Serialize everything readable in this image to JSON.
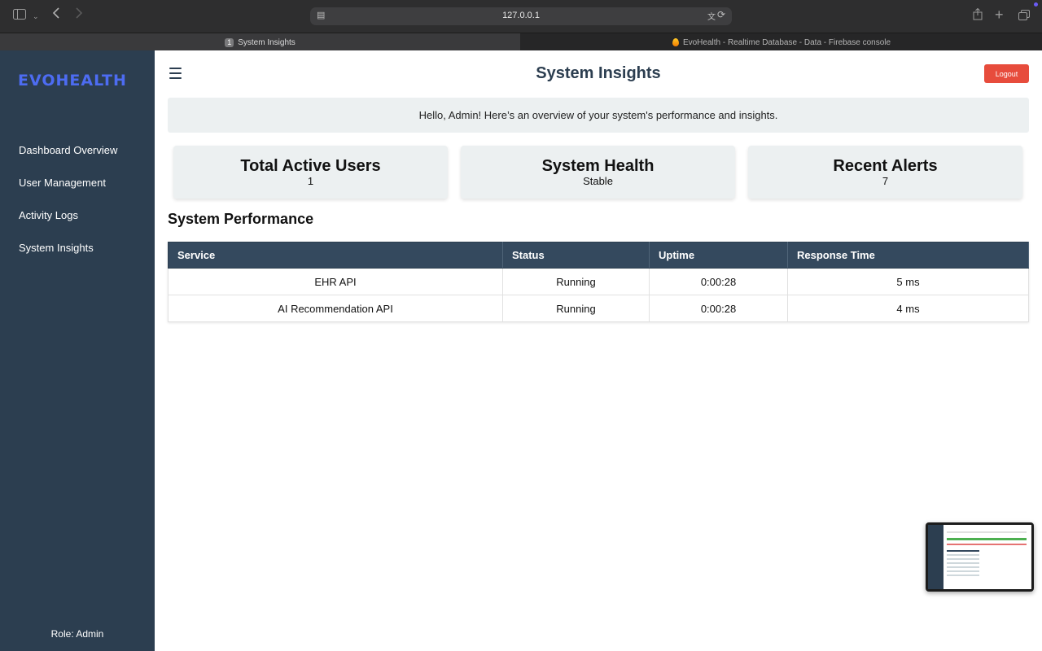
{
  "browser": {
    "url": "127.0.0.1",
    "tabs": [
      {
        "number": "1",
        "label": "System Insights",
        "active": true
      },
      {
        "label": "EvoHealth - Realtime Database - Data - Firebase console",
        "active": false
      }
    ],
    "icons": [
      "sidebar-toggle-icon",
      "chevron-down-icon",
      "back-icon",
      "forward-icon",
      "site-info-icon",
      "translate-icon",
      "reload-icon",
      "share-icon",
      "new-tab-icon",
      "tab-overview-icon"
    ]
  },
  "sidebar": {
    "logo": "EVOHEALTH",
    "items": [
      {
        "label": "Dashboard Overview"
      },
      {
        "label": "User Management"
      },
      {
        "label": "Activity Logs"
      },
      {
        "label": "System Insights"
      }
    ],
    "role": "Role: Admin"
  },
  "header": {
    "title": "System Insights",
    "logout_label": "Logout"
  },
  "welcome": "Hello, Admin! Here’s an overview of your system's performance and insights.",
  "cards": [
    {
      "title": "Total Active Users",
      "value": "1"
    },
    {
      "title": "System Health",
      "value": "Stable"
    },
    {
      "title": "Recent Alerts",
      "value": "7"
    }
  ],
  "performance": {
    "title": "System Performance",
    "columns": [
      "Service",
      "Status",
      "Uptime",
      "Response Time"
    ],
    "rows": [
      [
        "EHR API",
        "Running",
        "0:00:28",
        "5 ms"
      ],
      [
        "AI Recommendation API",
        "Running",
        "0:00:28",
        "4 ms"
      ]
    ]
  },
  "colors": {
    "sidebar": "#2c3e50",
    "table_header": "#34495e",
    "logout": "#e74c3c",
    "logo": "#4d6cf2",
    "card_bg": "#ecf0f1"
  }
}
